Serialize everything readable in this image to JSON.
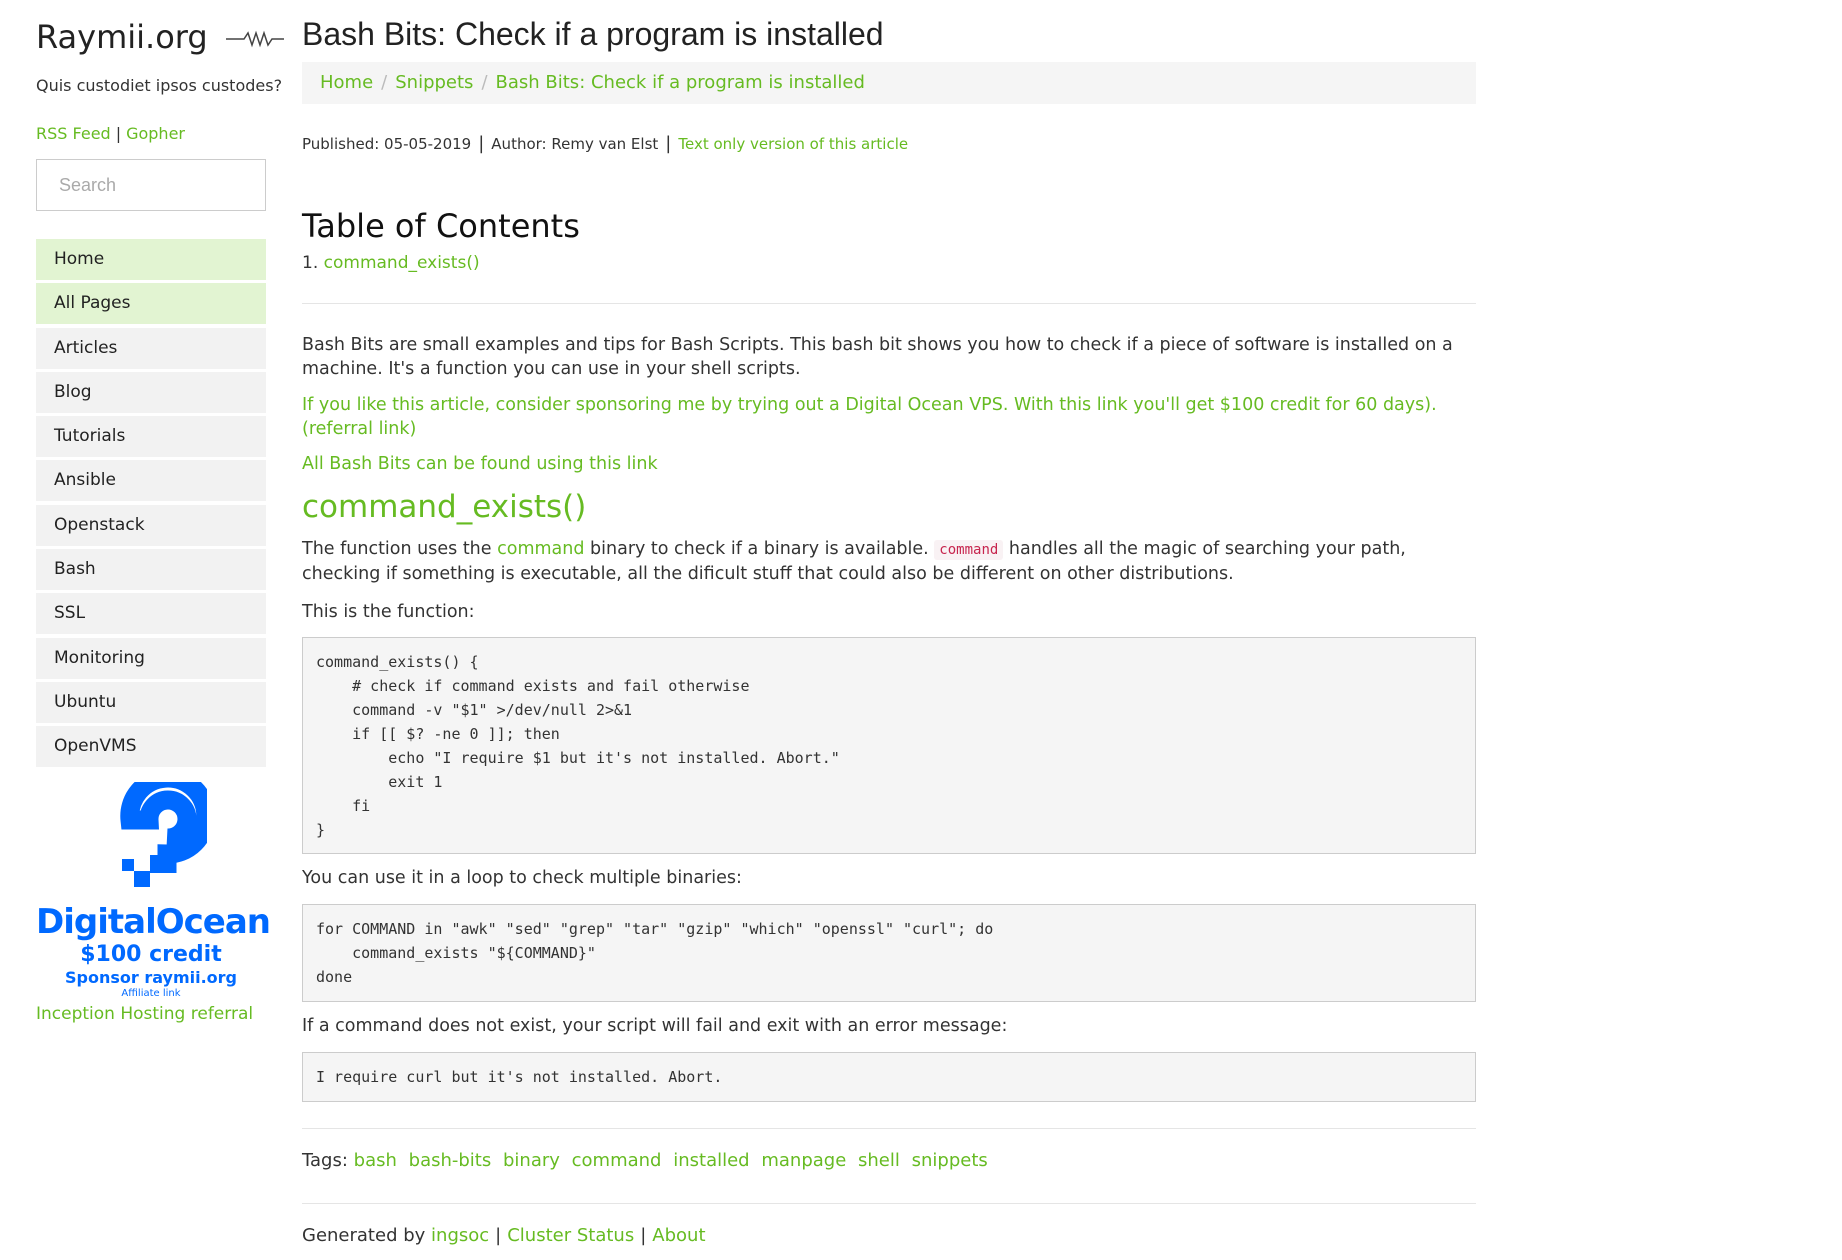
{
  "site": {
    "title": "Raymii.org",
    "motto": "Quis custodiet ipsos custodes?",
    "rss": "RSS Feed",
    "gopher": "Gopher",
    "search_placeholder": "Search"
  },
  "nav": [
    "Home",
    "All Pages",
    "Articles",
    "Blog",
    "Tutorials",
    "Ansible",
    "Openstack",
    "Bash",
    "SSL",
    "Monitoring",
    "Ubuntu",
    "OpenVMS"
  ],
  "ad": {
    "brand": "DigitalOcean",
    "credit": "$100 credit",
    "sponsor": "Sponsor raymii.org",
    "affiliate": "Affiliate link",
    "brand_color": "#0069ff",
    "inception": "Inception Hosting referral"
  },
  "article": {
    "title": "Bash Bits: Check if a program is installed",
    "breadcrumbs": [
      "Home",
      "Snippets",
      "Bash Bits: Check if a program is installed"
    ],
    "published": "Published: 05-05-2019",
    "author": "Author: Remy van Elst",
    "text_only": "Text only version of this article",
    "toc_heading": "Table of Contents",
    "toc_number": "1.",
    "toc_item": "command_exists()",
    "intro": "Bash Bits are small examples and tips for Bash Scripts. This bash bit shows you how to check if a piece of software is installed on a machine. It's a function you can use in your shell scripts.",
    "sponsor": "If you like this article, consider sponsoring me by trying out a Digital Ocean VPS. With this link you'll get $100 credit for 60 days). (referral link)",
    "all_bits": "All Bash Bits can be found using this link",
    "section_heading": "command_exists()",
    "p1_a": "The function uses the ",
    "p1_link": "command",
    "p1_b": " binary to check if a binary is available. ",
    "p1_code": "command",
    "p1_c": " handles all the magic of searching your path, checking if something is executable, all the dificult stuff that could also be different on other distributions.",
    "p2": "This is the function:",
    "code1": "command_exists() {\n    # check if command exists and fail otherwise\n    command -v \"$1\" >/dev/null 2>&1\n    if [[ $? -ne 0 ]]; then\n        echo \"I require $1 but it's not installed. Abort.\"\n        exit 1\n    fi\n}",
    "p3": "You can use it in a loop to check multiple binaries:",
    "code2": "for COMMAND in \"awk\" \"sed\" \"grep\" \"tar\" \"gzip\" \"which\" \"openssl\" \"curl\"; do\n    command_exists \"${COMMAND}\"\ndone",
    "p4": "If a command does not exist, your script will fail and exit with an error message:",
    "code3": "I require curl but it's not installed. Abort.",
    "tags_label": "Tags:",
    "tags": [
      "bash",
      "bash-bits",
      "binary",
      "command",
      "installed",
      "manpage",
      "shell",
      "snippets"
    ]
  },
  "footer": {
    "generated": "Generated by",
    "ingsoc": "ingsoc",
    "cluster": "Cluster Status",
    "about": "About"
  },
  "colors": {
    "link": "#66bb22",
    "nav_active": "#e2f4d2",
    "nav_bg": "#f2f2f2"
  }
}
